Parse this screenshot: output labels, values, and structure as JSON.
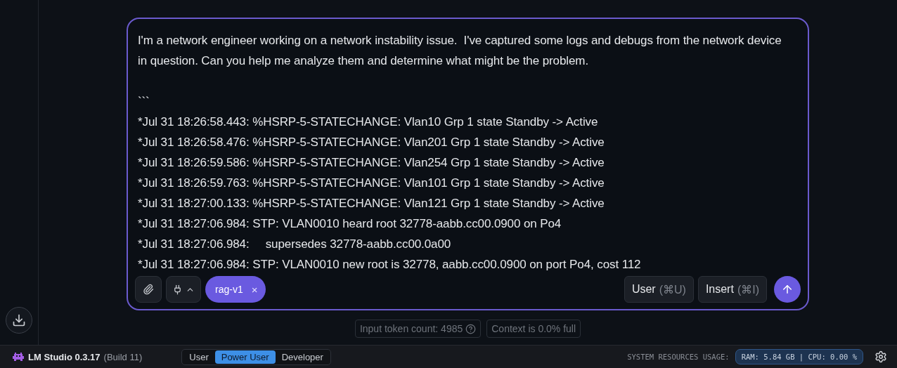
{
  "composer": {
    "intro": "I'm a network engineer working on a network instability issue.  I've captured some logs and debugs from the network device in question. Can you help me analyze them and determine what might be the problem.",
    "lines": [
      "```",
      "*Jul 31 18:26:58.443: %HSRP-5-STATECHANGE: Vlan10 Grp 1 state Standby -> Active",
      "*Jul 31 18:26:58.476: %HSRP-5-STATECHANGE: Vlan201 Grp 1 state Standby -> Active",
      "*Jul 31 18:26:59.586: %HSRP-5-STATECHANGE: Vlan254 Grp 1 state Standby -> Active",
      "*Jul 31 18:26:59.763: %HSRP-5-STATECHANGE: Vlan101 Grp 1 state Standby -> Active",
      "*Jul 31 18:27:00.133: %HSRP-5-STATECHANGE: Vlan121 Grp 1 state Standby -> Active",
      "*Jul 31 18:27:06.984: STP: VLAN0010 heard root 32778-aabb.cc00.0900 on Po4",
      "*Jul 31 18:27:06.984:     supersedes 32778-aabb.cc00.0a00",
      "*Jul 31 18:27:06.984: STP: VLAN0010 new root is 32778, aabb.cc00.0900 on port Po4, cost 112"
    ],
    "chip": {
      "label": "rag-v1",
      "remove": "×"
    },
    "actions": [
      {
        "label": "User",
        "shortcut": "(⌘U)"
      },
      {
        "label": "Insert",
        "shortcut": "(⌘I)"
      }
    ]
  },
  "info": {
    "token_count": "Input token count: 4985",
    "context": "Context is 0.0% full"
  },
  "status_bar": {
    "app_name": "LM Studio 0.3.17",
    "build": "(Build 11)",
    "modes": [
      {
        "label": "User",
        "selected": false
      },
      {
        "label": "Power User",
        "selected": true
      },
      {
        "label": "Developer",
        "selected": false
      }
    ],
    "usage_label": "SYSTEM RESOURCES USAGE:",
    "usage": "RAM: 5.84 GB | CPU: 0.00 %"
  }
}
